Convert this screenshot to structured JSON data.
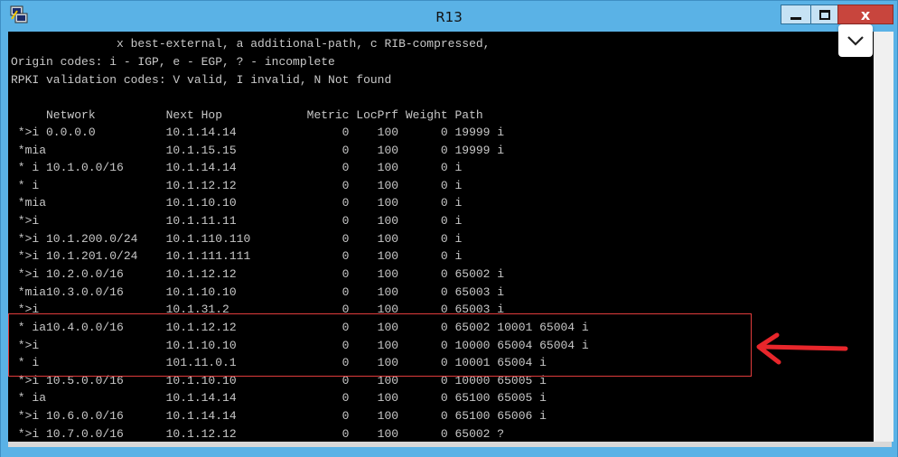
{
  "window": {
    "title": "R13",
    "close_label": "x"
  },
  "terminal": {
    "header_lines": [
      "               x best-external, a additional-path, c RIB-compressed,",
      "Origin codes: i - IGP, e - EGP, ? - incomplete",
      "RPKI validation codes: V valid, I invalid, N Not found"
    ],
    "columns": "     Network          Next Hop            Metric LocPrf Weight Path",
    "rows": [
      " *>i 0.0.0.0          10.1.14.14               0    100      0 19999 i",
      " *mia                 10.1.15.15               0    100      0 19999 i",
      " * i 10.1.0.0/16      10.1.14.14               0    100      0 i",
      " * i                  10.1.12.12               0    100      0 i",
      " *mia                 10.1.10.10               0    100      0 i",
      " *>i                  10.1.11.11               0    100      0 i",
      " *>i 10.1.200.0/24    10.1.110.110             0    100      0 i",
      " *>i 10.1.201.0/24    10.1.111.111             0    100      0 i",
      " *>i 10.2.0.0/16      10.1.12.12               0    100      0 65002 i",
      " *mia10.3.0.0/16      10.1.10.10               0    100      0 65003 i",
      " *>i                  10.1.31.2                0    100      0 65003 i",
      " * ia10.4.0.0/16      10.1.12.12               0    100      0 65002 10001 65004 i",
      " *>i                  10.1.10.10               0    100      0 10000 65004 65004 i",
      " * i                  101.11.0.1               0    100      0 10001 65004 i",
      " *>i 10.5.0.0/16      10.1.10.10               0    100      0 10000 65005 i",
      " * ia                 10.1.14.14               0    100      0 65100 65005 i",
      " *>i 10.6.0.0/16      10.1.14.14               0    100      0 65100 65006 i",
      " *>i 10.7.0.0/16      10.1.12.12               0    100      0 65002 ?"
    ]
  },
  "annotation": {
    "highlight_color": "#e03c3c",
    "arrow_color": "#e8262b"
  }
}
